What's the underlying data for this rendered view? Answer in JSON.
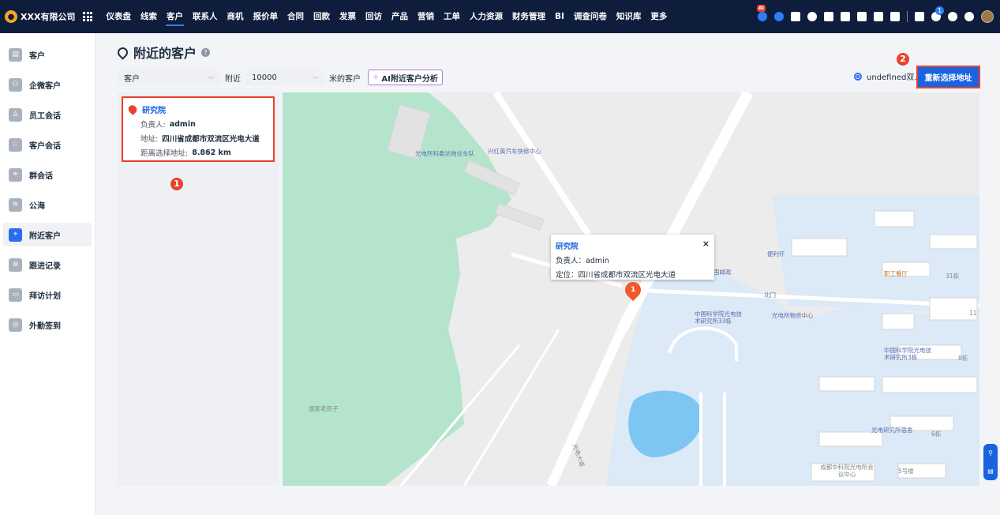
{
  "topbar": {
    "brand": "XXX有限公司",
    "nav": [
      "仪表盘",
      "线索",
      "客户",
      "联系人",
      "商机",
      "报价单",
      "合同",
      "回款",
      "发票",
      "回访",
      "产品",
      "营销",
      "工单",
      "人力资源",
      "财务管理",
      "BI",
      "调查问卷",
      "知识库",
      "更多"
    ],
    "active_nav": "客户",
    "ai_badge": "AI",
    "notification_count": "1",
    "colors": {
      "bar": "#0f1d3d",
      "accent": "#2f7cf6"
    }
  },
  "sidebar": {
    "items": [
      {
        "label": "客户",
        "icon": "customer-icon"
      },
      {
        "label": "企微客户",
        "icon": "wecom-customer-icon"
      },
      {
        "label": "员工会话",
        "icon": "staff-chat-icon"
      },
      {
        "label": "客户会话",
        "icon": "customer-chat-icon"
      },
      {
        "label": "群会话",
        "icon": "group-chat-icon"
      },
      {
        "label": "公海",
        "icon": "sea-icon"
      },
      {
        "label": "附近客户",
        "icon": "location-pin-icon"
      },
      {
        "label": "跟进记录",
        "icon": "followup-icon"
      },
      {
        "label": "拜访计划",
        "icon": "calendar-icon"
      },
      {
        "label": "外勤签到",
        "icon": "checkin-icon"
      }
    ],
    "active": "附近客户"
  },
  "page": {
    "title": "附近的客户"
  },
  "filters": {
    "type_value": "客户",
    "nearby_label": "附近",
    "distance_value": "10000",
    "unit_label": "米的客户",
    "ai_button": "AI附近客户分析"
  },
  "location": {
    "address_text": "undefined双...",
    "reselect_button": "重新选择地址"
  },
  "steps": {
    "one": "1",
    "two": "2"
  },
  "result_card": {
    "name": "研究院",
    "owner_label": "负责人:",
    "owner": "admin",
    "address_label": "地址:",
    "address": "四川省成都市双流区光电大道",
    "distance_label": "距离选择地址:",
    "distance": "8.862 km"
  },
  "map": {
    "popup": {
      "title": "研究院",
      "owner_line": "负责人：admin",
      "location_line": "定位：四川省成都市双流区光电大道",
      "close": "×"
    },
    "marker_label": "1",
    "pois": [
      "光电所科委达物业车队",
      "兴红英汽车快修中心",
      "便利仟",
      "国邮政",
      "职工餐厅",
      "北门",
      "中国科学院光电技术研究所33栋",
      "光电所物资中心",
      "中国科学院光电技术研究所3栋",
      "温家老房子",
      "光电研究所宿舍",
      "成都中科院光电所会议中心",
      "光电大道"
    ],
    "building_labels": [
      "31栋",
      "8栋",
      "6栋",
      "5号楼",
      "11"
    ]
  }
}
